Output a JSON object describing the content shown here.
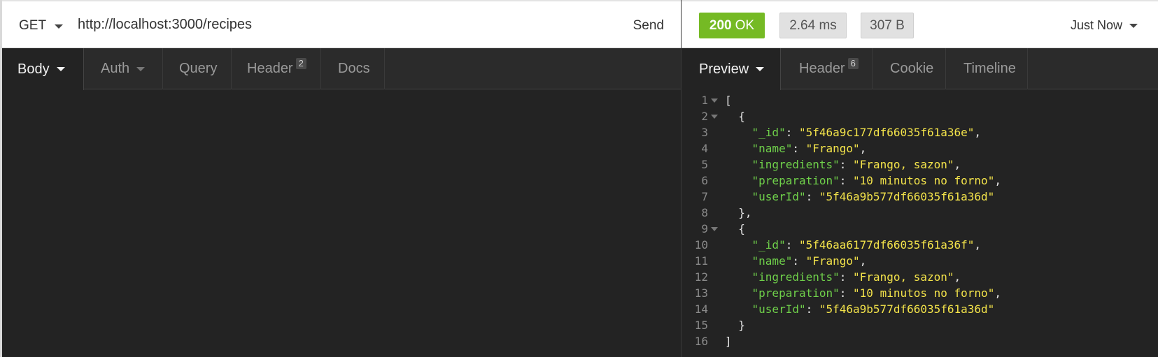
{
  "request": {
    "method": "GET",
    "url": "http://localhost:3000/recipes",
    "send_label": "Send",
    "tabs": [
      {
        "label": "Body"
      },
      {
        "label": "Auth"
      },
      {
        "label": "Query"
      },
      {
        "label": "Header",
        "count": "2"
      },
      {
        "label": "Docs"
      }
    ]
  },
  "response": {
    "status": "200 OK",
    "status_code": "200",
    "status_text": "OK",
    "time": "2.64 ms",
    "size": "307 B",
    "history": "Just Now",
    "tabs": [
      {
        "label": "Preview"
      },
      {
        "label": "Header",
        "count": "6"
      },
      {
        "label": "Cookie"
      },
      {
        "label": "Timeline"
      }
    ],
    "lines": [
      {
        "n": "1",
        "fold": true,
        "indent": "",
        "open": "["
      },
      {
        "n": "2",
        "fold": true,
        "indent": "  ",
        "open": "{"
      },
      {
        "n": "3",
        "indent": "    ",
        "key": "\"_id\"",
        "value": "\"5f46a9c177df66035f61a36e\"",
        "end": ","
      },
      {
        "n": "4",
        "indent": "    ",
        "key": "\"name\"",
        "value": "\"Frango\"",
        "end": ","
      },
      {
        "n": "5",
        "indent": "    ",
        "key": "\"ingredients\"",
        "value": "\"Frango, sazon\"",
        "end": ","
      },
      {
        "n": "6",
        "indent": "    ",
        "key": "\"preparation\"",
        "value": "\"10 minutos no forno\"",
        "end": ","
      },
      {
        "n": "7",
        "indent": "    ",
        "key": "\"userId\"",
        "value": "\"5f46a9b577df66035f61a36d\"",
        "end": ""
      },
      {
        "n": "8",
        "indent": "  ",
        "open": "},"
      },
      {
        "n": "9",
        "fold": true,
        "indent": "  ",
        "open": "{"
      },
      {
        "n": "10",
        "indent": "    ",
        "key": "\"_id\"",
        "value": "\"5f46aa6177df66035f61a36f\"",
        "end": ","
      },
      {
        "n": "11",
        "indent": "    ",
        "key": "\"name\"",
        "value": "\"Frango\"",
        "end": ","
      },
      {
        "n": "12",
        "indent": "    ",
        "key": "\"ingredients\"",
        "value": "\"Frango, sazon\"",
        "end": ","
      },
      {
        "n": "13",
        "indent": "    ",
        "key": "\"preparation\"",
        "value": "\"10 minutos no forno\"",
        "end": ","
      },
      {
        "n": "14",
        "indent": "    ",
        "key": "\"userId\"",
        "value": "\"5f46a9b577df66035f61a36d\"",
        "end": ""
      },
      {
        "n": "15",
        "indent": "  ",
        "open": "}"
      },
      {
        "n": "16",
        "indent": "",
        "open": "]"
      }
    ]
  },
  "colors": {
    "status_ok": "#75ba24",
    "json_key": "#6fd04a",
    "json_string": "#f3e34a",
    "background": "#232323"
  },
  "icons": [
    "caret-down-icon",
    "fold-arrow-icon"
  ]
}
